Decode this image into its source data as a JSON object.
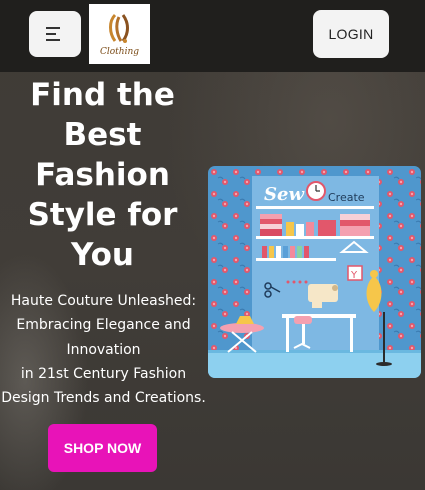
{
  "header": {
    "menu_icon": "hamburger-menu-icon",
    "logo_text": "Clothing",
    "login_label": "LOGIN"
  },
  "hero": {
    "headline_lines": [
      "Find the",
      "Best",
      "Fashion",
      "Style for",
      "You"
    ],
    "subtext_lines": [
      "Haute Couture Unleashed:",
      "Embracing Elegance and",
      "Innovation",
      "in 21st Century Fashion",
      "Design Trends and Creations."
    ],
    "cta_label": "SHOP NOW",
    "illustration_text": {
      "sew": "Sew",
      "create": "Create"
    }
  },
  "colors": {
    "cta": "#e813b8",
    "topbar": "#201f1d",
    "illustration_sky": "#5ba2d6"
  }
}
